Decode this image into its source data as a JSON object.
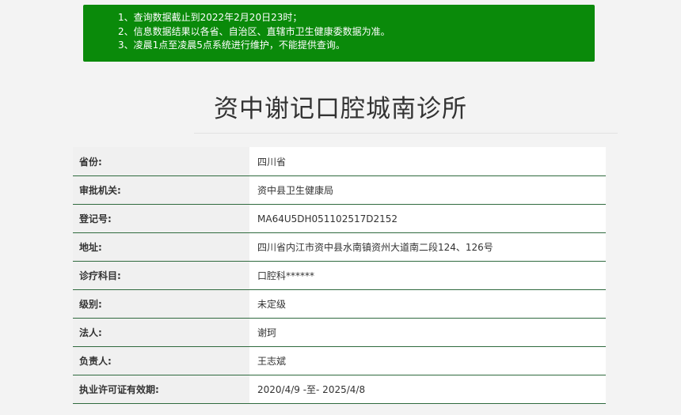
{
  "notice": {
    "lines": [
      "1、查询数据截止到2022年2月20日23时；",
      "2、信息数据结果以各省、自治区、直辖市卫生健康委数据为准。",
      "3、凌晨1点至凌晨5点系统进行维护，不能提供查询。"
    ],
    "bg_color": "#0a8a0a"
  },
  "title": "资中谢记口腔城南诊所",
  "rows": [
    {
      "label": "省份:",
      "value": "四川省"
    },
    {
      "label": "审批机关:",
      "value": "资中县卫生健康局"
    },
    {
      "label": "登记号:",
      "value": "MA64U5DH051102517D2152"
    },
    {
      "label": "地址:",
      "value": "四川省内江市资中县水南镇资州大道南二段124、126号"
    },
    {
      "label": "诊疗科目:",
      "value": "口腔科******"
    },
    {
      "label": "级别:",
      "value": "未定级"
    },
    {
      "label": "法人:",
      "value": "谢珂"
    },
    {
      "label": "负责人:",
      "value": "王志斌"
    },
    {
      "label": "执业许可证有效期:",
      "value": "2020/4/9 -至- 2025/4/8"
    }
  ]
}
